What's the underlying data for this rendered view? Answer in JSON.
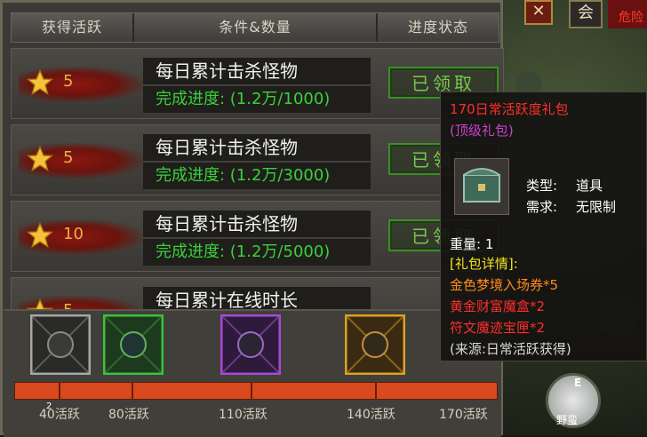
{
  "header": {
    "col_points": "获得活跃",
    "col_condition": "条件&数量",
    "col_status": "进度状态"
  },
  "rows": [
    {
      "points": "5",
      "task": "每日累计击杀怪物",
      "progress": "完成进度: (1.2万/1000)",
      "status": "已领取"
    },
    {
      "points": "5",
      "task": "每日累计击杀怪物",
      "progress": "完成进度: (1.2万/3000)",
      "status": "已领取"
    },
    {
      "points": "10",
      "task": "每日累计击杀怪物",
      "progress": "完成进度: (1.2万/5000)",
      "status": "已领取"
    },
    {
      "points": "5",
      "task": "每日累计在线时长",
      "progress": "",
      "status": ""
    }
  ],
  "milestones": [
    {
      "label": "40活跃",
      "badge": "2",
      "color": "#a7a7a7"
    },
    {
      "label": "80活跃",
      "badge": "",
      "color": "#3cc13c"
    },
    {
      "label": "110活跃",
      "badge": "",
      "color": "#a54ad8"
    },
    {
      "label": "140活跃",
      "badge": "",
      "color": "#e0a024"
    },
    {
      "label": "170活跃",
      "badge": "",
      "color": "#d0362a"
    }
  ],
  "activity_progress_fraction": 1.0,
  "top_buttons": {
    "close": "✕",
    "guild": "会",
    "danger": "危险"
  },
  "tooltip": {
    "title": "170日常活跃度礼包",
    "subtitle": "(顶级礼包)",
    "type_label": "类型:",
    "type_value": "道具",
    "req_label": "需求:",
    "req_value": "无限制",
    "weight": "重量: 1",
    "details_header": "[礼包详情]:",
    "items": [
      "金色梦境入场券*5",
      "黄金财富魔盒*2",
      "符文魔迹宝匣*2"
    ],
    "source": "(来源:日常活跃获得)"
  },
  "hud": {
    "key": "E",
    "label": "野蛮"
  },
  "colors": {
    "accent_red": "#d0362a",
    "progress_green": "#39d13a",
    "points_gold": "#e8b04a"
  }
}
